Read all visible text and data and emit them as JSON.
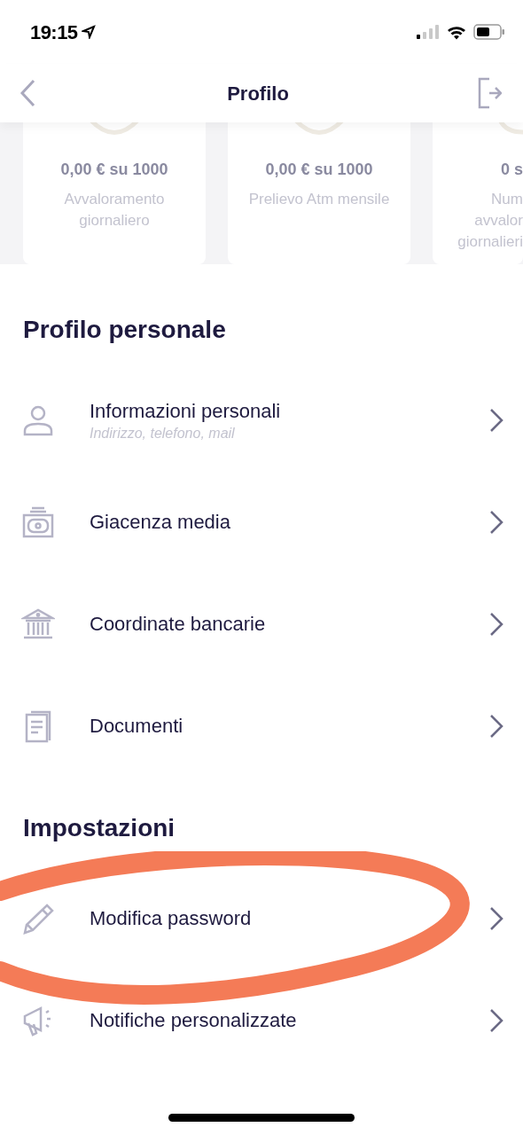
{
  "status_bar": {
    "time": "19:15"
  },
  "header": {
    "title": "Profilo"
  },
  "limit_cards": [
    {
      "amount": "0,00 € su 1000",
      "label_lines": [
        "Avvaloramento",
        "giornaliero"
      ]
    },
    {
      "amount": "0,00 € su 1000",
      "label_lines": [
        "Prelievo Atm mensile"
      ]
    },
    {
      "amount": "0 s",
      "label_lines": [
        "Num",
        "avvalor",
        "giornalieri"
      ]
    }
  ],
  "sections": [
    {
      "title": "Profilo personale",
      "items": [
        {
          "kind": "person",
          "label": "Informazioni personali",
          "subtitle": "Indirizzo, telefono, mail"
        },
        {
          "kind": "cash",
          "label": "Giacenza media"
        },
        {
          "kind": "bank",
          "label": "Coordinate bancarie"
        },
        {
          "kind": "document",
          "label": "Documenti"
        }
      ]
    },
    {
      "title": "Impostazioni",
      "items": [
        {
          "kind": "pencil",
          "label": "Modifica password"
        },
        {
          "kind": "megaphone",
          "label": "Notifiche personalizzate"
        }
      ]
    }
  ]
}
